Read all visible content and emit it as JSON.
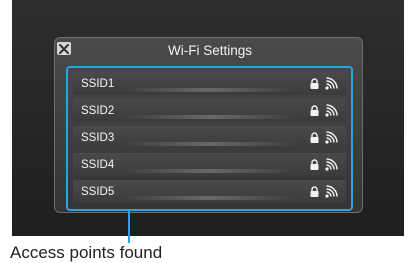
{
  "dialog": {
    "title": "Wi-Fi Settings"
  },
  "networks": [
    {
      "ssid": "SSID1",
      "secured": true
    },
    {
      "ssid": "SSID2",
      "secured": true
    },
    {
      "ssid": "SSID3",
      "secured": true
    },
    {
      "ssid": "SSID4",
      "secured": true
    },
    {
      "ssid": "SSID5",
      "secured": true
    }
  ],
  "icons": {
    "close": "close-icon",
    "lock": "lock-icon",
    "signal": "wifi-signal-icon"
  },
  "annotation": {
    "caption": "Access points found"
  },
  "colors": {
    "highlight": "#29a3e6",
    "dialog_bg": "#3f3f3f",
    "screen_bg": "#262626"
  }
}
